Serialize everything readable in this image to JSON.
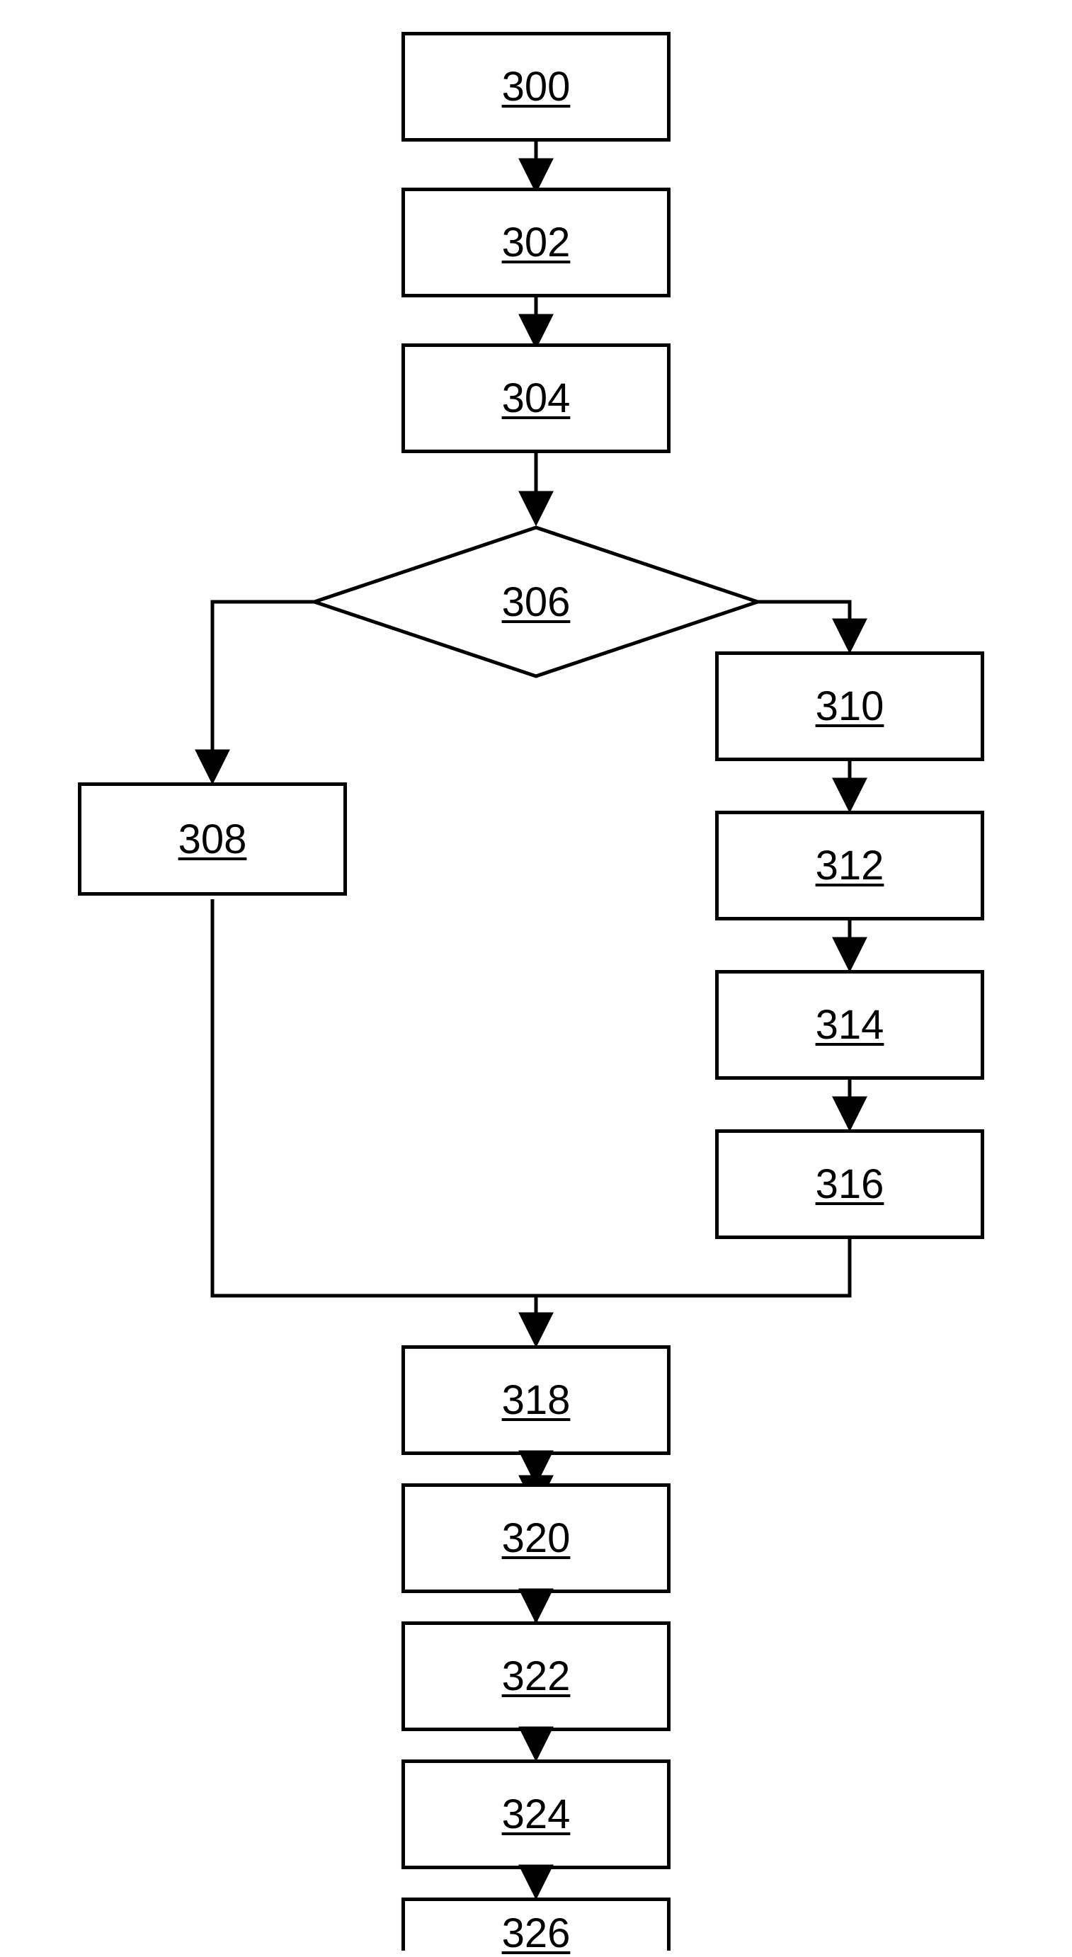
{
  "flowchart": {
    "nodes": {
      "n300": "300",
      "n302": "302",
      "n304": "304",
      "n306": "306",
      "n308": "308",
      "n310": "310",
      "n312": "312",
      "n314": "314",
      "n316": "316",
      "n318": "318",
      "n320": "320",
      "n322": "322",
      "n324": "324",
      "n326": "326"
    },
    "structure": "300 -> 302 -> 304 -> 306 (decision) -> {left: 308, right: 310 -> 312 -> 314 -> 316} -> merge -> 318 -> 320 -> 322 -> 324 -> 326"
  }
}
